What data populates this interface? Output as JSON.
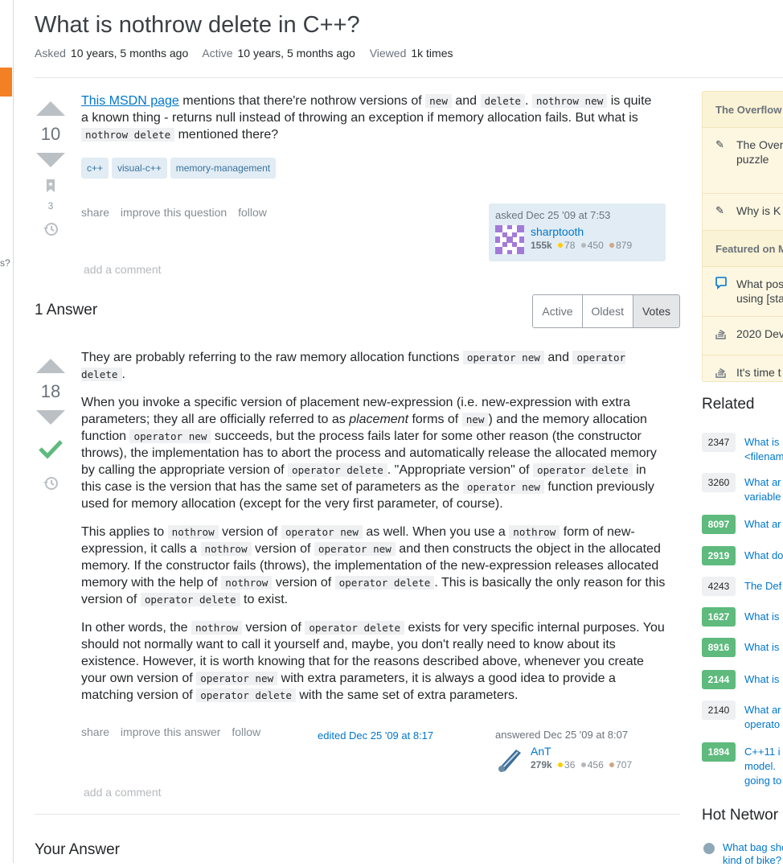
{
  "question": {
    "title": "What is nothrow delete in C++?",
    "meta": [
      {
        "label": "Asked",
        "value": "10 years, 5 months ago"
      },
      {
        "label": "Active",
        "value": "10 years, 5 months ago"
      },
      {
        "label": "Viewed",
        "value": "1k times"
      }
    ],
    "votes": "10",
    "bookmarks": "3",
    "body": {
      "link_text": "This MSDN page",
      "t1": " mentions that there're nothrow versions of ",
      "c1": "new",
      "t2": " and ",
      "c2": "delete",
      "t3": ". ",
      "c3": "nothrow new",
      "t4": " is quite a known thing - returns null instead of throwing an exception if memory allocation fails. But what is ",
      "c4": "nothrow delete",
      "t5": " mentioned there?"
    },
    "tags": [
      "c++",
      "visual-c++",
      "memory-management"
    ],
    "menu": [
      "share",
      "improve this question",
      "follow"
    ],
    "add_comment": "add a comment",
    "asked": {
      "action": "asked Dec 25 '09 at 7:53",
      "user": "sharptooth",
      "rep": "155k",
      "gold": "78",
      "silver": "450",
      "bronze": "879"
    }
  },
  "answers_header": {
    "count": "1 Answer",
    "tabs": [
      "Active",
      "Oldest",
      "Votes"
    ],
    "selected": "Votes"
  },
  "answer": {
    "votes": "18",
    "p1": {
      "t1": "They are probably referring to the raw memory allocation functions ",
      "c1": "operator new",
      "t2": " and ",
      "c2": "operator delete",
      "t3": "."
    },
    "p2": {
      "t1": "When you invoke a specific version of placement new-expression (i.e. new-expression with extra parameters; they all are officially referred to as ",
      "em": "placement",
      "t2": " forms of ",
      "c1": "new",
      "t3": ") and the memory allocation function ",
      "c2": "operator new",
      "t4": " succeeds, but the process fails later for some other reason (the constructor throws), the implementation has to abort the process and automatically release the allocated memory by calling the appropriate version of ",
      "c3": "operator delete",
      "t5": ". \"Appropriate version\" of ",
      "c4": "operator delete",
      "t6": " in this case is the version that has the same set of parameters as the ",
      "c5": "operator new",
      "t7": " function previously used for memory allocation (except for the very first parameter, of course)."
    },
    "p3": {
      "t1": "This applies to ",
      "c1": "nothrow",
      "t2": " version of ",
      "c2": "operator new",
      "t3": " as well. When you use a ",
      "c3": "nothrow",
      "t4": " form of new-expression, it calls a ",
      "c4": "nothrow",
      "t5": " version of ",
      "c5": "operator new",
      "t6": " and then constructs the object in the allocated memory. If the constructor fails (throws), the implementation of the new-expression releases allocated memory with the help of ",
      "c6": "nothrow",
      "t7": " version of ",
      "c7": "operator delete",
      "t8": ". This is basically the only reason for this version of ",
      "c8": "operator delete",
      "t9": " to exist."
    },
    "p4": {
      "t1": "In other words, the ",
      "c1": "nothrow",
      "t2": " version of ",
      "c2": "operator delete",
      "t3": " exists for very specific internal purposes. You should not normally want to call it yourself and, maybe, you don't really need to know about its existence. However, it is worth knowing that for the reasons described above, whenever you create your own version of ",
      "c3": "operator new",
      "t4": " with extra parameters, it is always a good idea to provide a matching version of ",
      "c4": "operator delete",
      "t5": " with the same set of extra parameters."
    },
    "menu": [
      "share",
      "improve this answer",
      "follow"
    ],
    "edited": "edited Dec 25 '09 at 8:17",
    "add_comment": "add a comment",
    "answered": {
      "action": "answered Dec 25 '09 at 8:07",
      "user": "AnT",
      "rep": "279k",
      "gold": "36",
      "silver": "456",
      "bronze": "707"
    }
  },
  "your_answer": "Your Answer",
  "left_rail": {
    "fragment": "s?"
  },
  "sidebar": {
    "blog_header": "The Overflow",
    "blog_items": [
      {
        "icon": "pencil-icon",
        "text": "The Over\npuzzle"
      },
      {
        "icon": "pencil-icon",
        "text": "Why is K"
      }
    ],
    "featured_header": "Featured on M",
    "featured_items": [
      {
        "icon": "chat-bubble-icon",
        "text": "What pos\nusing [sta"
      },
      {
        "icon": "stack-icon",
        "text": "2020 Dev"
      },
      {
        "icon": "stack-icon",
        "text": "It's time t"
      }
    ]
  },
  "related": {
    "title": "Related",
    "items": [
      {
        "score": "2347",
        "accepted": false,
        "text": "What is\n<filenam"
      },
      {
        "score": "3260",
        "accepted": false,
        "text": "What ar\nvariable"
      },
      {
        "score": "8097",
        "accepted": true,
        "text": "What ar"
      },
      {
        "score": "2919",
        "accepted": true,
        "text": "What do"
      },
      {
        "score": "4243",
        "accepted": false,
        "text": "The Def"
      },
      {
        "score": "1627",
        "accepted": true,
        "text": "What is"
      },
      {
        "score": "8916",
        "accepted": true,
        "text": "What is"
      },
      {
        "score": "2144",
        "accepted": true,
        "text": "What is"
      },
      {
        "score": "2140",
        "accepted": false,
        "text": "What ar\noperato"
      },
      {
        "score": "1894",
        "accepted": true,
        "text": "C++11 i\nmodel. \ngoing to"
      }
    ]
  },
  "hot": {
    "title": "Hot Networ",
    "item": "What bag sho\nkind of bike?"
  },
  "colors": {
    "link": "#0077cc",
    "accepted": "#5eba7d",
    "tag_bg": "#e1ecf4",
    "tag_fg": "#39739d",
    "accent": "#f48024"
  }
}
